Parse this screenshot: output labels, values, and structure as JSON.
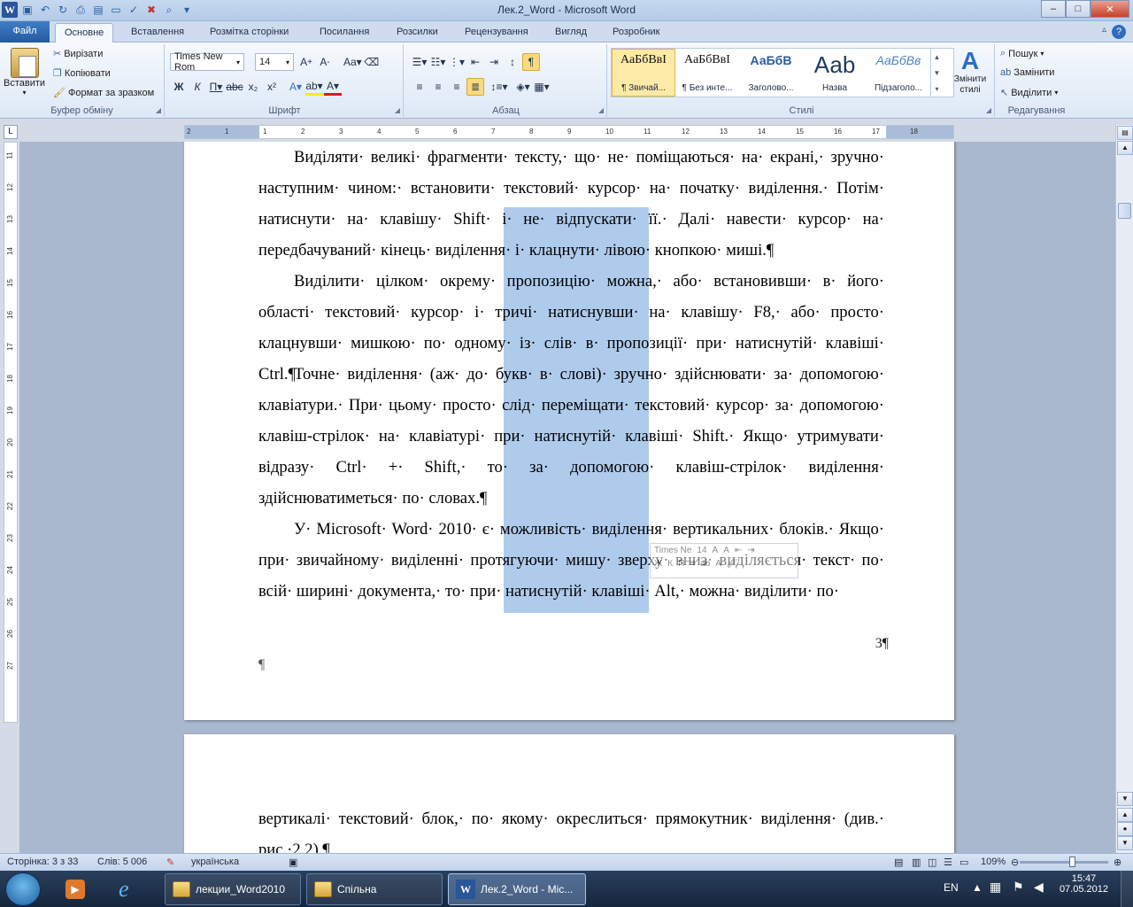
{
  "window": {
    "title": "Лек.2_Word - Microsoft Word",
    "controls": {
      "minimize": "–",
      "maximize": "□",
      "close": "✕"
    }
  },
  "tabs": {
    "file": "Файл",
    "items": [
      "Основне",
      "Вставлення",
      "Розмітка сторінки",
      "Посилання",
      "Розсилки",
      "Рецензування",
      "Вигляд",
      "Розробник"
    ]
  },
  "ribbon": {
    "clipboard": {
      "label": "Буфер обміну",
      "paste": "Вставити",
      "cut": "Вирізати",
      "copy": "Копіювати",
      "format_painter": "Формат за зразком"
    },
    "font": {
      "label": "Шрифт",
      "family": "Times New Rom",
      "size": "14"
    },
    "paragraph": {
      "label": "Абзац"
    },
    "styles": {
      "label": "Стилі",
      "items": [
        {
          "preview": "АаБбВвІ",
          "name": "¶ Звичай..."
        },
        {
          "preview": "АаБбВвІ",
          "name": "¶ Без инте..."
        },
        {
          "preview": "АаБбВ",
          "name": "Заголово..."
        },
        {
          "preview": "Ааb",
          "name": "Назва"
        },
        {
          "preview": "АаБбВв",
          "name": "Підзаголо..."
        }
      ],
      "change": "Змінити стилі"
    },
    "editing": {
      "label": "Редагування",
      "find": "Пошук",
      "replace": "Замінити",
      "select": "Виділити"
    }
  },
  "ruler": {
    "h_numbers": [
      "2",
      "1",
      "1",
      "2",
      "3",
      "4",
      "5",
      "6",
      "7",
      "8",
      "9",
      "10",
      "11",
      "12",
      "13",
      "14",
      "15",
      "16",
      "17",
      "18"
    ],
    "v_numbers": [
      "11",
      "12",
      "13",
      "14",
      "15",
      "16",
      "17",
      "18",
      "19",
      "20",
      "21",
      "22",
      "23",
      "24",
      "25",
      "26",
      "27"
    ]
  },
  "document": {
    "paragraphs": [
      "Виділяти· великі· фрагменти· тексту,· що· не· поміщаються· на· екрані,· зручно· наступним· чином:· встановити· текстовий· курсор· на· початку· виділення.· Потім· натиснути· на· клавішу· Shift· і· не· відпускати· її.· Далі· навести· курсор· на· передбачуваний· кінець· виділення· і· клацнути· лівою· кнопкою· миші.¶",
      "Виділити· цілком· окрему· пропозицію· можна,· або· встановивши· в· його· області· текстовий· курсор· і· тричі· натиснувши· на· клавішу· F8,· або· просто· клацнувши· мишкою· по· одному· із· слів· в· пропозиції· при· натиснутій· клавіші· Ctrl.¶",
      "Точне· виділення· (аж· до· букв· в· слові)· зручно· здійснювати· за· допомогою· клавіатури.· При· цьому· просто· слід· переміщати· текстовий· курсор· за· допомогою· клавіш-стрілок· на· клавіатурі· при· натиснутій· клавіші· Shift.· Якщо· утримувати· відразу· Ctrl· +· Shift,· то· за· допомогою· клавіш-стрілок· виділення· здійснюватиметься· по· словах.¶",
      "У· Microsoft· Word· 2010· є· можливість· виділення· вертикальних· блоків.· Якщо· при· звичайному· виділенні· протягуючи· мишу· зверху· вниз· виділяється· текст· по· всій· ширині· документа,· то· при· натиснутій· клавіші· Alt,· можна· виділити· по·"
    ],
    "page_number": "3¶",
    "empty_para": "¶",
    "page2_text": "вертикалі· текстовий· блок,· по· якому· окреслиться· прямокутник· виділення· (див.· рис.·2.2).¶"
  },
  "mini_toolbar": {
    "font": "Times Ne",
    "size": "14"
  },
  "status": {
    "page": "Сторінка: 3 з 33",
    "words": "Слів: 5 006",
    "language": "українська",
    "zoom": "109%"
  },
  "taskbar": {
    "apps": [
      {
        "label": "лекции_Word2010"
      },
      {
        "label": "Спільна"
      },
      {
        "label": "Лек.2_Word - Mic..."
      }
    ],
    "lang": "EN",
    "time": "15:47",
    "date": "07.05.2012"
  }
}
